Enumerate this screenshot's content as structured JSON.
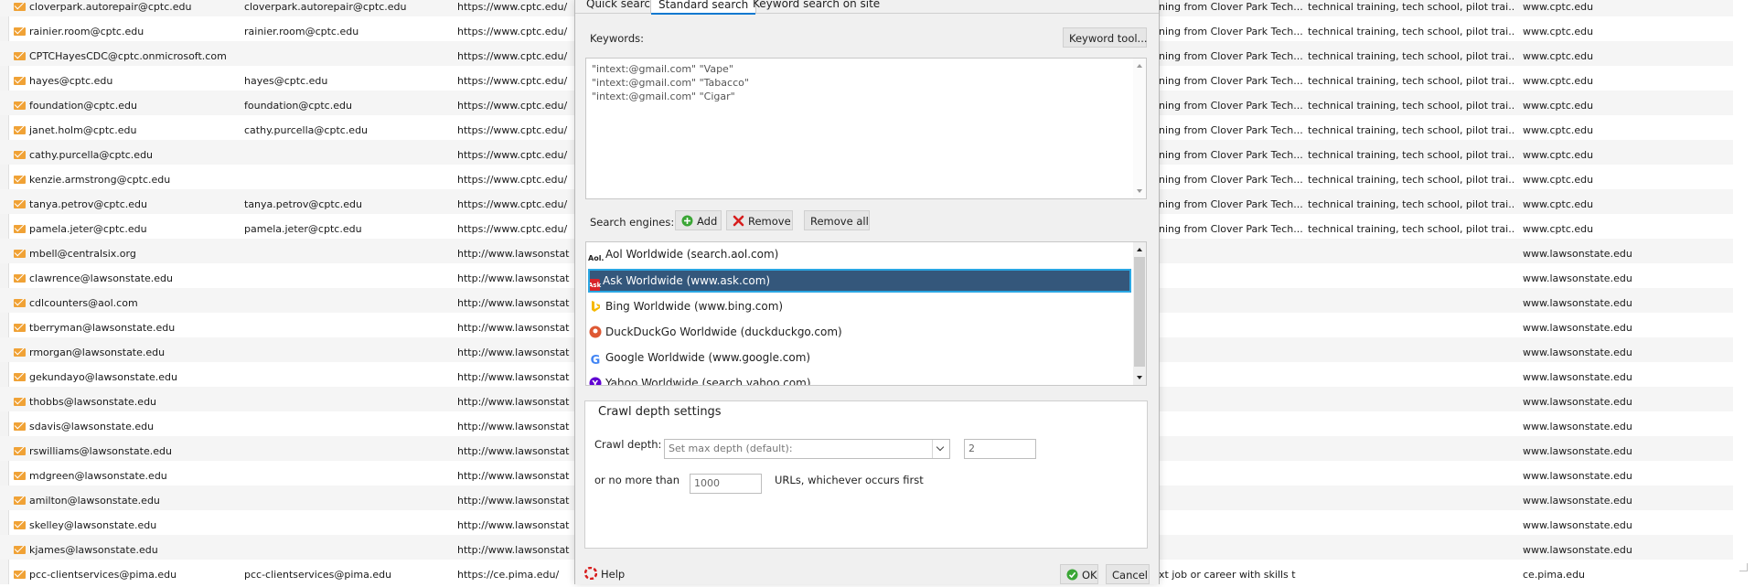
{
  "rows": [
    {
      "email": "cloverpark.autorepair@cptc.edu",
      "alt": "cloverpark.autorepair@cptc.edu",
      "url": "https://www.cptc.edu/",
      "title": "ning from Clover Park Tech...",
      "keywords": "technical training, tech school, pilot trai...",
      "domain": "www.cptc.edu"
    },
    {
      "email": "rainier.room@cptc.edu",
      "alt": "rainier.room@cptc.edu",
      "url": "https://www.cptc.edu/",
      "title": "ning from Clover Park Tech...",
      "keywords": "technical training, tech school, pilot trai...",
      "domain": "www.cptc.edu"
    },
    {
      "email": "CPTCHayesCDC@cptc.onmicrosoft.com",
      "alt": "",
      "url": "https://www.cptc.edu/",
      "title": "ning from Clover Park Tech...",
      "keywords": "technical training, tech school, pilot trai...",
      "domain": "www.cptc.edu"
    },
    {
      "email": "hayes@cptc.edu",
      "alt": "hayes@cptc.edu",
      "url": "https://www.cptc.edu/",
      "title": "ning from Clover Park Tech...",
      "keywords": "technical training, tech school, pilot trai...",
      "domain": "www.cptc.edu"
    },
    {
      "email": "foundation@cptc.edu",
      "alt": "foundation@cptc.edu",
      "url": "https://www.cptc.edu/",
      "title": "ning from Clover Park Tech...",
      "keywords": "technical training, tech school, pilot trai...",
      "domain": "www.cptc.edu"
    },
    {
      "email": "janet.holm@cptc.edu",
      "alt": "cathy.purcella@cptc.edu",
      "url": "https://www.cptc.edu/",
      "title": "ning from Clover Park Tech...",
      "keywords": "technical training, tech school, pilot trai...",
      "domain": "www.cptc.edu"
    },
    {
      "email": "cathy.purcella@cptc.edu",
      "alt": "",
      "url": "https://www.cptc.edu/",
      "title": "ning from Clover Park Tech...",
      "keywords": "technical training, tech school, pilot trai...",
      "domain": "www.cptc.edu"
    },
    {
      "email": "kenzie.armstrong@cptc.edu",
      "alt": "",
      "url": "https://www.cptc.edu/",
      "title": "ning from Clover Park Tech...",
      "keywords": "technical training, tech school, pilot trai...",
      "domain": "www.cptc.edu"
    },
    {
      "email": "tanya.petrov@cptc.edu",
      "alt": "tanya.petrov@cptc.edu",
      "url": "https://www.cptc.edu/",
      "title": "ning from Clover Park Tech...",
      "keywords": "technical training, tech school, pilot trai...",
      "domain": "www.cptc.edu"
    },
    {
      "email": "pamela.jeter@cptc.edu",
      "alt": "pamela.jeter@cptc.edu",
      "url": "https://www.cptc.edu/",
      "title": "ning from Clover Park Tech...",
      "keywords": "technical training, tech school, pilot trai...",
      "domain": "www.cptc.edu"
    },
    {
      "email": "mbell@centralsix.org",
      "alt": "",
      "url": "http://www.lawsonstat",
      "title": "",
      "keywords": "",
      "domain": "www.lawsonstate.edu"
    },
    {
      "email": "clawrence@lawsonstate.edu",
      "alt": "",
      "url": "http://www.lawsonstat",
      "title": "",
      "keywords": "",
      "domain": "www.lawsonstate.edu"
    },
    {
      "email": "cdlcounters@aol.com",
      "alt": "",
      "url": "http://www.lawsonstat",
      "title": "",
      "keywords": "",
      "domain": "www.lawsonstate.edu"
    },
    {
      "email": "tberryman@lawsonstate.edu",
      "alt": "",
      "url": "http://www.lawsonstat",
      "title": "",
      "keywords": "",
      "domain": "www.lawsonstate.edu"
    },
    {
      "email": "rmorgan@lawsonstate.edu",
      "alt": "",
      "url": "http://www.lawsonstat",
      "title": "",
      "keywords": "",
      "domain": "www.lawsonstate.edu"
    },
    {
      "email": "gekundayo@lawsonstate.edu",
      "alt": "",
      "url": "http://www.lawsonstat",
      "title": "",
      "keywords": "",
      "domain": "www.lawsonstate.edu"
    },
    {
      "email": "thobbs@lawsonstate.edu",
      "alt": "",
      "url": "http://www.lawsonstat",
      "title": "",
      "keywords": "",
      "domain": "www.lawsonstate.edu"
    },
    {
      "email": "sdavis@lawsonstate.edu",
      "alt": "",
      "url": "http://www.lawsonstat",
      "title": "",
      "keywords": "",
      "domain": "www.lawsonstate.edu"
    },
    {
      "email": "rswilliams@lawsonstate.edu",
      "alt": "",
      "url": "http://www.lawsonstat",
      "title": "",
      "keywords": "",
      "domain": "www.lawsonstate.edu"
    },
    {
      "email": "mdgreen@lawsonstate.edu",
      "alt": "",
      "url": "http://www.lawsonstat",
      "title": "",
      "keywords": "",
      "domain": "www.lawsonstate.edu"
    },
    {
      "email": "amilton@lawsonstate.edu",
      "alt": "",
      "url": "http://www.lawsonstat",
      "title": "",
      "keywords": "",
      "domain": "www.lawsonstate.edu"
    },
    {
      "email": "skelley@lawsonstate.edu",
      "alt": "",
      "url": "http://www.lawsonstat",
      "title": "",
      "keywords": "",
      "domain": "www.lawsonstate.edu"
    },
    {
      "email": "kjames@lawsonstate.edu",
      "alt": "",
      "url": "http://www.lawsonstat",
      "title": "",
      "keywords": "",
      "domain": "www.lawsonstate.edu"
    },
    {
      "email": "pcc-clientservices@pima.edu",
      "alt": "pcc-clientservices@pima.edu",
      "url": "https://ce.pima.edu/",
      "title": "xt job or career with skills t",
      "keywords": "",
      "domain": "ce.pima.edu"
    }
  ],
  "dialog": {
    "tabs": [
      "Quick search",
      "Standard search",
      "Keyword search on site"
    ],
    "active_tab": 1,
    "keywords_label": "Keywords:",
    "keyword_tool_label": "Keyword tool...",
    "keywords": [
      "\"intext:@gmail.com\" \"Vape\"",
      "\"intext:@gmail.com\" \"Tabacco\"",
      "\"intext:@gmail.com\" \"Cigar\""
    ],
    "engines_label": "Search engines:",
    "add_label": "Add",
    "remove_label": "Remove",
    "remove_all_label": "Remove all",
    "engines": [
      {
        "name": "Aol Worldwide (search.aol.com)",
        "icon": "aol-icon",
        "color": "#000000"
      },
      {
        "name": "Ask Worldwide (www.ask.com)",
        "icon": "ask-icon",
        "color": "#d8232a",
        "selected": true
      },
      {
        "name": "Bing Worldwide (www.bing.com)",
        "icon": "bing-icon",
        "color": "#f5b800"
      },
      {
        "name": "DuckDuckGo Worldwide (duckduckgo.com)",
        "icon": "duckduckgo-icon",
        "color": "#de5833"
      },
      {
        "name": "Google Worldwide (www.google.com)",
        "icon": "google-icon",
        "color": "#4285f4"
      },
      {
        "name": "Yahoo Worldwide (search.yahoo.com)",
        "icon": "yahoo-icon",
        "color": "#6001d2"
      }
    ],
    "crawl_title": "Crawl depth settings",
    "crawl_depth_label": "Crawl depth:",
    "crawl_select_value": "Set max depth (default):",
    "crawl_depth_value": "2",
    "no_more_than_label": "or no more than",
    "url_limit_value": "1000",
    "url_limit_suffix": "URLs, whichever occurs first",
    "help_label": "Help",
    "ok_label": "OK",
    "cancel_label": "Cancel"
  },
  "colors": {
    "accent": "#0a78d0",
    "selection": "#34577b",
    "mail_icon": "#f0a236"
  }
}
